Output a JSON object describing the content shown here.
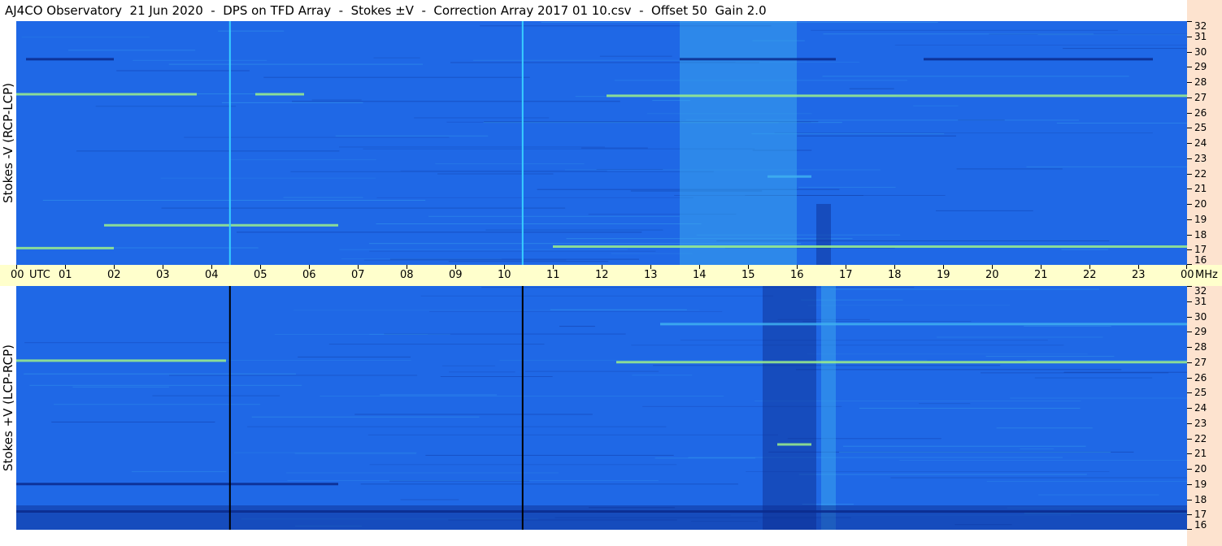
{
  "window": {
    "title": "AJ4CO Observatory  21 Jun 2020  -  DPS on TFD Array  -  Stokes ±V  -  Correction Array 2017 01 10.csv  -  Offset 50  Gain 2.0"
  },
  "colors": {
    "background": "#ffffff",
    "time_axis_band": "#ffffcc",
    "freq_axis_band": "#fde3cf",
    "spectrogram_base": "#1f68e6",
    "spectrogram_dark": "#0a2a8c",
    "spectrogram_light": "#3fb0f0",
    "spectrogram_hot": "#9ef08a"
  },
  "chart_data": {
    "type": "heatmap",
    "title": "AJ4CO Observatory  21 Jun 2020  -  DPS on TFD Array  -  Stokes ±V  -  Correction Array 2017 01 10.csv  -  Offset 50  Gain 2.0",
    "x_axis": {
      "quantity": "time",
      "range_hours": [
        0,
        24
      ],
      "tick_labels": [
        "00",
        "01",
        "02",
        "03",
        "04",
        "05",
        "06",
        "07",
        "08",
        "09",
        "10",
        "11",
        "12",
        "13",
        "14",
        "15",
        "16",
        "17",
        "18",
        "19",
        "20",
        "21",
        "22",
        "23",
        "00"
      ],
      "unit_label": "UTC",
      "freq_unit_label": "MHz"
    },
    "y_axis": {
      "quantity": "frequency",
      "unit": "MHz",
      "range": [
        16,
        32
      ],
      "tick_values": [
        16,
        17,
        18,
        19,
        20,
        21,
        22,
        23,
        24,
        25,
        26,
        27,
        28,
        29,
        30,
        31,
        32
      ]
    },
    "panels": [
      {
        "id": "top",
        "ylabel": "Stokes -V (RCP-LCP)",
        "vertical_lines_utc": [
          4.38,
          10.38
        ],
        "vertical_line_color": "#38d0ff",
        "horizontal_bands_mhz": [
          {
            "freq": 29.5,
            "t_start": 0.2,
            "t_end": 2.0,
            "tone": "dark"
          },
          {
            "freq": 29.5,
            "t_start": 13.6,
            "t_end": 16.8,
            "tone": "dark"
          },
          {
            "freq": 29.5,
            "t_start": 18.6,
            "t_end": 23.3,
            "tone": "dark"
          },
          {
            "freq": 27.2,
            "t_start": 0.0,
            "t_end": 3.7,
            "tone": "hot"
          },
          {
            "freq": 27.2,
            "t_start": 4.9,
            "t_end": 5.9,
            "tone": "hot"
          },
          {
            "freq": 27.1,
            "t_start": 12.1,
            "t_end": 24.0,
            "tone": "hot"
          },
          {
            "freq": 21.8,
            "t_start": 15.4,
            "t_end": 16.3,
            "tone": "light"
          },
          {
            "freq": 18.6,
            "t_start": 1.8,
            "t_end": 6.6,
            "tone": "hot"
          },
          {
            "freq": 17.1,
            "t_start": 0.0,
            "t_end": 2.0,
            "tone": "hot"
          },
          {
            "freq": 17.2,
            "t_start": 11.0,
            "t_end": 24.0,
            "tone": "hot"
          }
        ],
        "emission_regions": [
          {
            "t_start": 13.6,
            "t_end": 16.0,
            "f_low": 16,
            "f_high": 32,
            "tone": "light"
          },
          {
            "t_start": 16.4,
            "t_end": 16.7,
            "f_low": 16,
            "f_high": 20,
            "tone": "dark"
          }
        ]
      },
      {
        "id": "bottom",
        "ylabel": "Stokes +V (LCP-RCP)",
        "vertical_lines_utc": [
          4.38,
          10.38
        ],
        "vertical_line_color": "#000000",
        "horizontal_bands_mhz": [
          {
            "freq": 29.5,
            "t_start": 13.2,
            "t_end": 24.0,
            "tone": "light"
          },
          {
            "freq": 27.1,
            "t_start": 0.0,
            "t_end": 4.3,
            "tone": "hot"
          },
          {
            "freq": 27.0,
            "t_start": 12.3,
            "t_end": 24.0,
            "tone": "hot"
          },
          {
            "freq": 21.6,
            "t_start": 15.6,
            "t_end": 16.3,
            "tone": "hot"
          },
          {
            "freq": 19.0,
            "t_start": 0.0,
            "t_end": 6.6,
            "tone": "dark"
          },
          {
            "freq": 17.2,
            "t_start": 0.0,
            "t_end": 24.0,
            "tone": "dark"
          }
        ],
        "emission_regions": [
          {
            "t_start": 15.3,
            "t_end": 16.4,
            "f_low": 16,
            "f_high": 32,
            "tone": "dark"
          },
          {
            "t_start": 16.5,
            "t_end": 16.8,
            "f_low": 16,
            "f_high": 32,
            "tone": "light"
          },
          {
            "t_start": 0.0,
            "t_end": 24.0,
            "f_low": 16,
            "f_high": 17.6,
            "tone": "dark"
          }
        ]
      }
    ]
  }
}
